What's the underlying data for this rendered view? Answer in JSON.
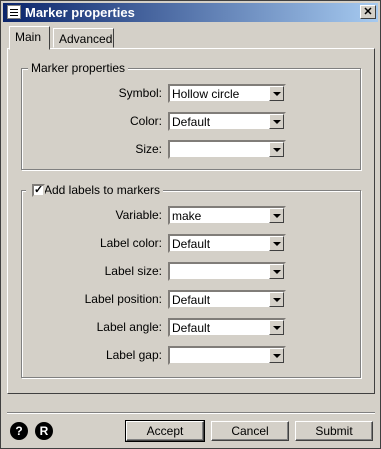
{
  "window": {
    "title": "Marker properties",
    "close_glyph": "✕"
  },
  "tabs": [
    {
      "label": "Main",
      "active": true
    },
    {
      "label": "Advanced",
      "active": false
    }
  ],
  "marker_group": {
    "title": "Marker properties",
    "rows": [
      {
        "label": "Symbol:",
        "value": "Hollow circle"
      },
      {
        "label": "Color:",
        "value": "Default"
      },
      {
        "label": "Size:",
        "value": ""
      }
    ]
  },
  "labels_group": {
    "checkbox_label": "Add labels to markers",
    "checked": true,
    "check_glyph": "✓",
    "rows": [
      {
        "label": "Variable:",
        "value": "make"
      },
      {
        "label": "Label color:",
        "value": "Default"
      },
      {
        "label": "Label size:",
        "value": ""
      },
      {
        "label": "Label position:",
        "value": "Default"
      },
      {
        "label": "Label angle:",
        "value": "Default"
      },
      {
        "label": "Label gap:",
        "value": ""
      }
    ]
  },
  "footer": {
    "help_glyph": "?",
    "reset_glyph": "R",
    "accept_label": "Accept",
    "cancel_label": "Cancel",
    "submit_label": "Submit"
  }
}
